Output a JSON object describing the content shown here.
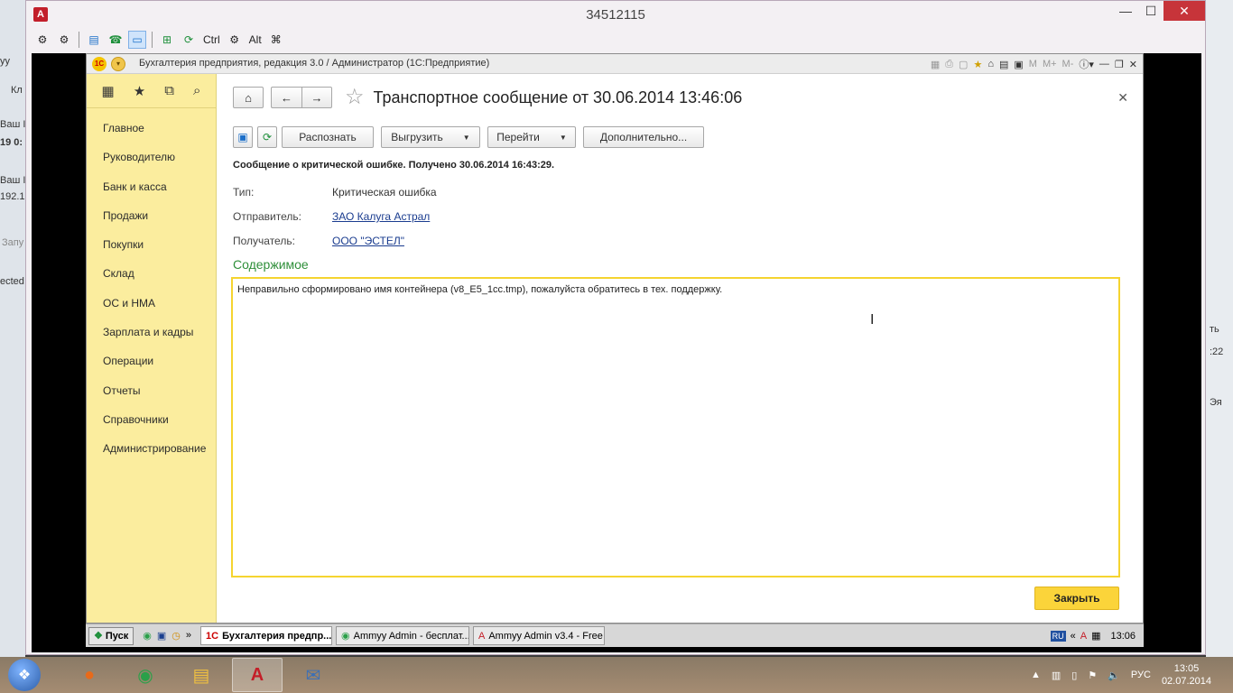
{
  "ammyy": {
    "title": "34512115",
    "logo_letter": "A",
    "toolbar": [
      {
        "name": "remote-cursor-icon",
        "glyph": "⚙"
      },
      {
        "name": "remote-settings-icon",
        "glyph": "⚙"
      },
      {
        "name": "file-manager-icon",
        "glyph": "▤"
      },
      {
        "name": "voice-chat-icon",
        "glyph": "☎"
      },
      {
        "name": "fullscreen-icon",
        "glyph": "▭"
      },
      {
        "name": "scale-icon",
        "glyph": "⊞"
      },
      {
        "name": "refresh-icon",
        "glyph": "⟳"
      }
    ],
    "ctrl_label": "Ctrl",
    "alt_label": "Alt",
    "minimize": "—",
    "maximize": "☐",
    "close": "✕"
  },
  "desktop_left": [
    "уу",
    "Кл",
    "Ваш I",
    "19 0:",
    "Ваш I",
    "192.1",
    "Запу",
    "ected"
  ],
  "desktop_right": [
    "ть",
    ":22",
    "Эя"
  ],
  "onec": {
    "logo": "1С",
    "title": "Бухгалтерия предприятия, редакция 3.0 / Администратор  (1С:Предприятие)",
    "title_icons": [
      "M",
      "M+",
      "M-"
    ],
    "sidebar": [
      "Главное",
      "Руководителю",
      "Банк и касса",
      "Продажи",
      "Покупки",
      "Склад",
      "ОС и НМА",
      "Зарплата и кадры",
      "Операции",
      "Отчеты",
      "Справочники",
      "Администрирование"
    ],
    "doc_title": "Транспортное сообщение от 30.06.2014 13:46:06",
    "buttons": {
      "recognize": "Распознать",
      "unload": "Выгрузить",
      "go": "Перейти",
      "more": "Дополнительно..."
    },
    "message_header": "Сообщение о критической ошибке. Получено 30.06.2014 16:43:29.",
    "fields": {
      "type_label": "Тип:",
      "type_value": "Критическая ошибка",
      "sender_label": "Отправитель:",
      "sender_value": "ЗАО Калуга Астрал",
      "recipient_label": "Получатель:",
      "recipient_value": "ООО \"ЭСТЕЛ\""
    },
    "content_title": "Содержимое",
    "content_text": "Неправильно сформировано имя контейнера (v8_E5_1cc.tmp), пожалуйста обратитесь в тех. поддержку.",
    "close_button": "Закрыть"
  },
  "remote_taskbar": {
    "start": "Пуск",
    "tasks": [
      "Бухгалтерия предпр...",
      "Ammyy Admin - бесплат...",
      "Ammyy Admin v3.4 - Free"
    ],
    "lang": "RU",
    "time": "13:06"
  },
  "local_taskbar": {
    "apps": [
      {
        "name": "firefox-icon",
        "glyph": "●",
        "color": "#e86a1a"
      },
      {
        "name": "chrome-icon",
        "glyph": "◉",
        "color": "#2aa049"
      },
      {
        "name": "file-explorer-icon",
        "glyph": "▤",
        "color": "#f0c040"
      },
      {
        "name": "ammyy-admin-icon",
        "glyph": "A",
        "color": "#c41e28"
      },
      {
        "name": "thunderbird-icon",
        "glyph": "✉",
        "color": "#3b6fb6"
      }
    ],
    "lang": "РУС",
    "time": "13:05",
    "date": "02.07.2014"
  },
  "colors": {
    "sidebar_bg": "#fbed9e",
    "accent_yellow": "#fbd43a",
    "section_green": "#2f8f3a",
    "link_blue": "#1a3c8f"
  }
}
